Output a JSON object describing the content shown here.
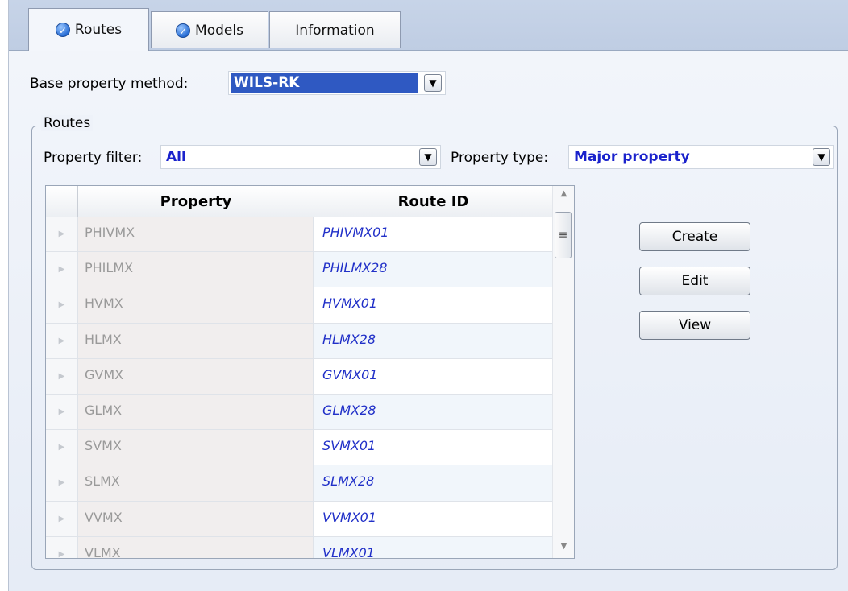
{
  "tabs": [
    {
      "label": "Routes",
      "icon": "check-icon",
      "active": true
    },
    {
      "label": "Models",
      "icon": "check-icon",
      "active": false
    },
    {
      "label": "Information",
      "active": false
    }
  ],
  "base_property_method": {
    "label": "Base property method:",
    "value": "WILS-RK"
  },
  "routes_group": {
    "title": "Routes",
    "property_filter": {
      "label": "Property filter:",
      "value": "All"
    },
    "property_type": {
      "label": "Property type:",
      "value": "Major property"
    }
  },
  "grid": {
    "columns": [
      "Property",
      "Route ID"
    ],
    "rows": [
      {
        "property": "PHIVMX",
        "route_id": "PHIVMX01"
      },
      {
        "property": "PHILMX",
        "route_id": "PHILMX28"
      },
      {
        "property": "HVMX",
        "route_id": "HVMX01"
      },
      {
        "property": "HLMX",
        "route_id": "HLMX28"
      },
      {
        "property": "GVMX",
        "route_id": "GVMX01"
      },
      {
        "property": "GLMX",
        "route_id": "GLMX28"
      },
      {
        "property": "SVMX",
        "route_id": "SVMX01"
      },
      {
        "property": "SLMX",
        "route_id": "SLMX28"
      },
      {
        "property": "VVMX",
        "route_id": "VVMX01"
      },
      {
        "property": "VLMX",
        "route_id": "VLMX01"
      }
    ]
  },
  "buttons": {
    "create": "Create",
    "edit": "Edit",
    "view": "View"
  },
  "colors": {
    "accent": "#2f59c2",
    "route_id_text": "#2130c8",
    "tab_strip": "#c7d4e8"
  }
}
